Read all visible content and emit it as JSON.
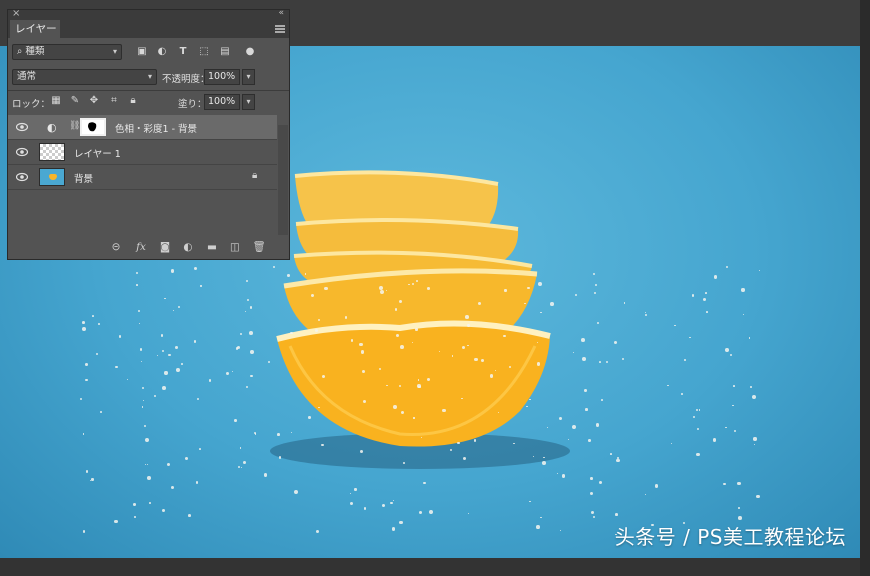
{
  "panel": {
    "close_glyph": "×",
    "collapse_glyph": "«",
    "tab_label": "レイヤー",
    "filter": {
      "kind_label": "種類",
      "search_glyph": "⌕"
    },
    "filter_icons": [
      "image-filter-icon",
      "adjustment-filter-icon",
      "type-filter-icon",
      "shape-filter-icon",
      "smart-object-filter-icon",
      "filter-toggle-icon"
    ],
    "blend_mode": "通常",
    "opacity_label": "不透明度：",
    "opacity_value": "100%",
    "lock_label": "ロック：",
    "fill_label": "塗り：",
    "fill_value": "100%",
    "layers": [
      {
        "name": "色相・彩度1 - 背景",
        "type": "adjustment",
        "selected": true
      },
      {
        "name": "レイヤー 1",
        "type": "pixel",
        "selected": false
      },
      {
        "name": "背景",
        "type": "background",
        "selected": false,
        "locked": true
      }
    ],
    "bottom_icons": [
      "link-layers-icon",
      "fx-icon",
      "add-mask-icon",
      "new-adjustment-icon",
      "new-group-icon",
      "new-layer-icon",
      "delete-layer-icon"
    ],
    "fx_label": "fx"
  },
  "watermark": "头条号 / PS美工教程论坛",
  "colors": {
    "background_blue": "#4aa8d2",
    "panel_bg": "#535353",
    "selected_layer": "#6a6a6a",
    "lemon": "#f7b52a"
  }
}
